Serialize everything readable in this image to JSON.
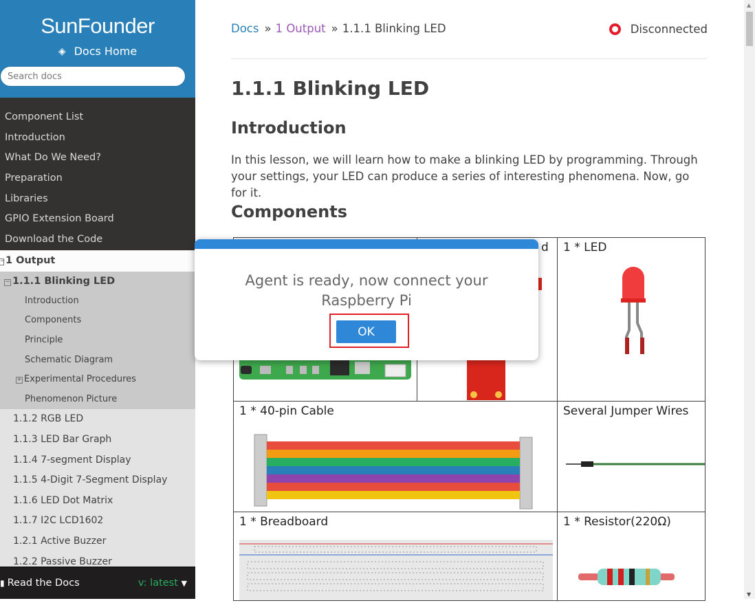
{
  "sidebar": {
    "brand": "SunFounder",
    "docs_home": "Docs Home",
    "search_placeholder": "Search docs",
    "top_items": [
      "Component List",
      "Introduction",
      "What Do We Need?",
      "Preparation",
      "Libraries",
      "GPIO Extension Board",
      "Download the Code"
    ],
    "section": "1 Output",
    "current": "1.1.1 Blinking LED",
    "current_children": [
      "Introduction",
      "Components",
      "Principle",
      "Schematic Diagram",
      "Experimental Procedures",
      "Phenomenon Picture"
    ],
    "siblings": [
      "1.1.2 RGB LED",
      "1.1.3 LED Bar Graph",
      "1.1.4 7-segment Display",
      "1.1.5 4-Digit 7-Segment Display",
      "1.1.6 LED Dot Matrix",
      "1.1.7 I2C LCD1602",
      "1.2.1 Active Buzzer",
      "1.2.2 Passive Buzzer"
    ],
    "rtd_label": "Read the Docs",
    "rtd_version": "v: latest"
  },
  "breadcrumb": {
    "home": "Docs",
    "sep": "»",
    "parent": "1 Output",
    "current": "1.1.1 Blinking LED"
  },
  "status": {
    "text": "Disconnected",
    "color": "#e31c2d"
  },
  "page": {
    "title": "1.1.1 Blinking LED",
    "intro_heading": "Introduction",
    "intro_text": "In this lesson, we will learn how to make a blinking LED by programming. Through your settings, your LED can produce a series of interesting phenomena. Now, go for it.",
    "components_heading": "Components"
  },
  "components": {
    "led": "1 * LED",
    "board_partial": "d",
    "cable": "1 * 40-pin Cable",
    "jumper": "Several Jumper Wires",
    "breadboard": "1 * Breadboard",
    "resistor": "1 * Resistor(220Ω)"
  },
  "modal": {
    "message": "Agent is ready, now connect your Raspberry Pi",
    "ok_label": "OK"
  },
  "colors": {
    "accent": "#2980b9",
    "modal_blue": "#2f87d8",
    "highlight": "#e21f26"
  }
}
